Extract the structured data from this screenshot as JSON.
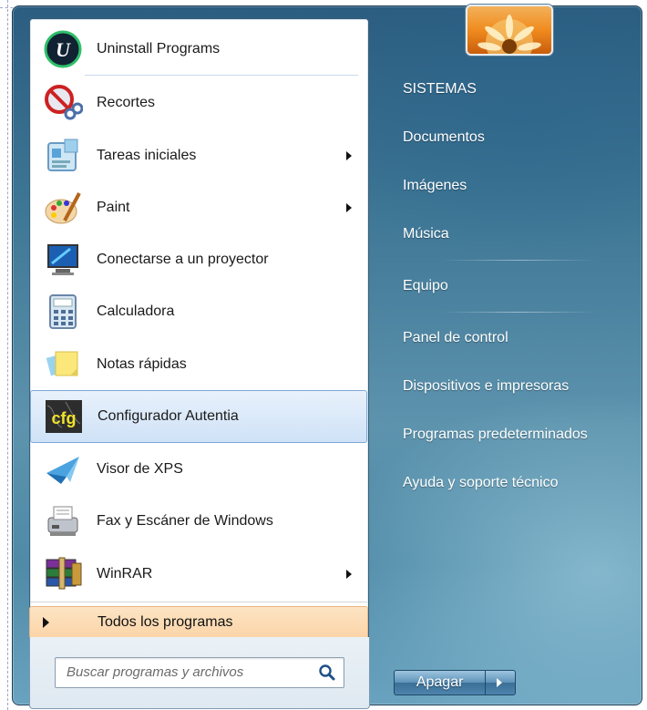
{
  "programs": [
    {
      "label": "Uninstall Programs",
      "icon": "uninstall-programs-icon",
      "submenu": false
    },
    {
      "label": "Recortes",
      "icon": "snipping-tool-icon",
      "submenu": false
    },
    {
      "label": "Tareas iniciales",
      "icon": "getting-started-icon",
      "submenu": true
    },
    {
      "label": "Paint",
      "icon": "paint-icon",
      "submenu": true
    },
    {
      "label": "Conectarse a un proyector",
      "icon": "projector-icon",
      "submenu": false
    },
    {
      "label": "Calculadora",
      "icon": "calculator-icon",
      "submenu": false
    },
    {
      "label": "Notas rápidas",
      "icon": "sticky-notes-icon",
      "submenu": false
    },
    {
      "label": "Configurador Autentia",
      "icon": "cfg-icon",
      "submenu": false,
      "highlighted": true,
      "badge": "cfg"
    },
    {
      "label": "Visor de XPS",
      "icon": "xps-viewer-icon",
      "submenu": false
    },
    {
      "label": "Fax y Escáner de Windows",
      "icon": "fax-scanner-icon",
      "submenu": false
    },
    {
      "label": "WinRAR",
      "icon": "winrar-icon",
      "submenu": true
    }
  ],
  "all_programs": {
    "label": "Todos los programas"
  },
  "search": {
    "placeholder": "Buscar programas y archivos"
  },
  "right_links": [
    {
      "label": "SISTEMAS"
    },
    {
      "label": "Documentos"
    },
    {
      "label": "Imágenes"
    },
    {
      "label": "Música"
    },
    {
      "label": "Equipo"
    },
    {
      "label": "Panel de control"
    },
    {
      "label": "Dispositivos e impresoras"
    },
    {
      "label": "Programas predeterminados"
    },
    {
      "label": "Ayuda y soporte técnico"
    }
  ],
  "shutdown": {
    "label": "Apagar"
  },
  "colors": {
    "accent": "#3f7796",
    "highlight": "#cfe2f7",
    "all_programs_bg": "#fbd4a7"
  }
}
